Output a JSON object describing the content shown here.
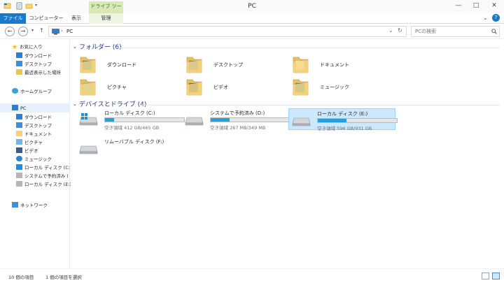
{
  "window": {
    "title": "PC",
    "contextual_tab": "ドライブ ツール",
    "minimize": "—",
    "maximize": "□",
    "close": "✕"
  },
  "ribbon": {
    "tabs": [
      "ファイル",
      "コンピューター",
      "表示",
      "管理"
    ],
    "help": "?",
    "expand": "⌄"
  },
  "address": {
    "back": "←",
    "forward": "→",
    "recent": "▾",
    "up": "↑",
    "crumb_sep": "›",
    "location": "PC",
    "dropdown": "⌄",
    "refresh": "↻",
    "search_placeholder": "PCの検索",
    "search_icon": "search-icon"
  },
  "navpane": {
    "favorites_label": "お気に入り",
    "favorites": [
      "ダウンロード",
      "デスクトップ",
      "最近表示した場所"
    ],
    "homegroup_label": "ホームグループ",
    "pc_label": "PC",
    "pc_items": [
      "ダウンロード",
      "デスクトップ",
      "ドキュメント",
      "ピクチャ",
      "ビデオ",
      "ミュージック",
      "ローカル ディスク (C:)",
      "システムで予約済み (",
      "ローカル ディスク (E:)"
    ],
    "network_label": "ネットワーク"
  },
  "folders": {
    "header": "フォルダー (6)",
    "items": [
      {
        "name": "ダウンロード",
        "icon": "downloads-folder-icon"
      },
      {
        "name": "デスクトップ",
        "icon": "desktop-folder-icon"
      },
      {
        "name": "ドキュメント",
        "icon": "documents-folder-icon"
      },
      {
        "name": "ピクチャ",
        "icon": "pictures-folder-icon"
      },
      {
        "name": "ビデオ",
        "icon": "videos-folder-icon"
      },
      {
        "name": "ミュージック",
        "icon": "music-folder-icon"
      }
    ]
  },
  "drives": {
    "header": "デバイスとドライブ (4)",
    "items": [
      {
        "name": "ローカル ディスク (C:)",
        "space": "空き領域 412 GB/465 GB",
        "used_fraction": 0.114,
        "selected": false
      },
      {
        "name": "システムで予約済み (D:)",
        "space": "空き領域 267 MB/349 MB",
        "used_fraction": 0.235,
        "selected": false
      },
      {
        "name": "ローカル ディスク (E:)",
        "space": "空き領域 596 GB/931 GB",
        "used_fraction": 0.36,
        "selected": true
      },
      {
        "name": "リムーバブル ディスク (F:)",
        "space": "",
        "used_fraction": null,
        "selected": false
      }
    ]
  },
  "status": {
    "count": "10 個の項目",
    "selected": "1 個の項目を選択"
  },
  "colors": {
    "accent": "#1979ca",
    "drive_fill": "#26a0da",
    "selection": "#cce8ff",
    "group_header": "#1e3287"
  }
}
